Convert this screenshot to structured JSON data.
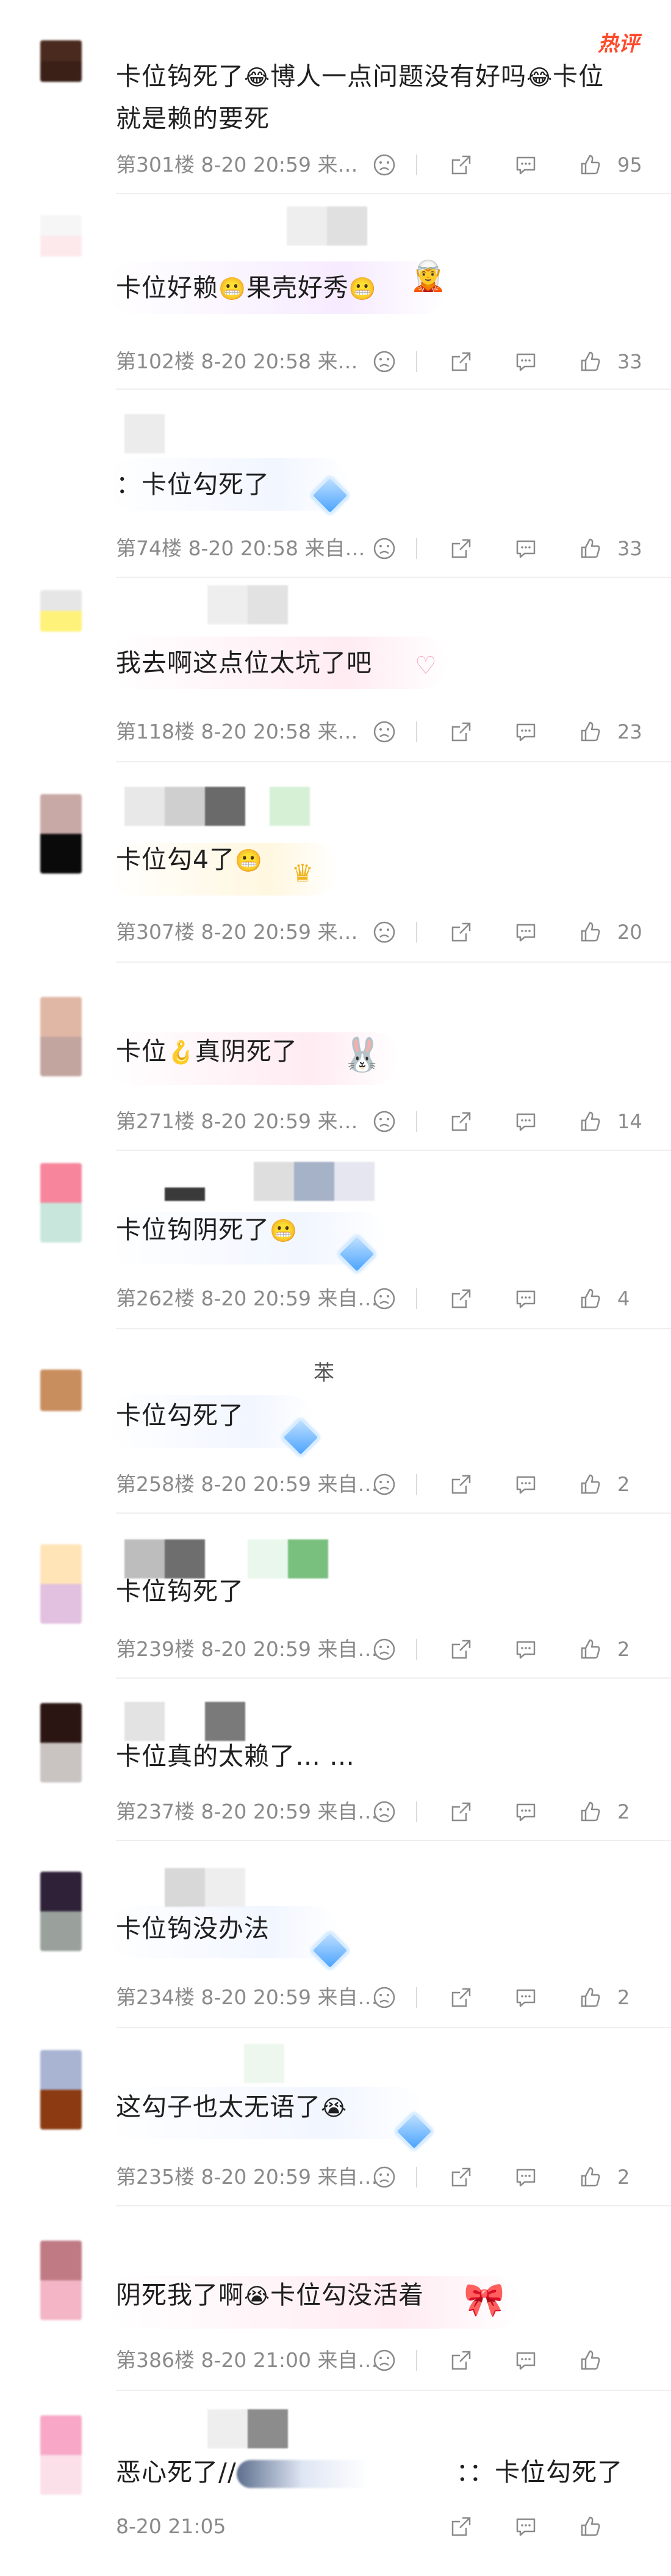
{
  "hot_badge": "热评",
  "comments": [
    {
      "content_a": "卡位钩死了",
      "emoji_a": "😂",
      "content_b": "博人一点问题没有好吗",
      "emoji_b": "😂",
      "content_c": "卡位",
      "content_line2": "就是赖的要死",
      "meta": "第301楼  8-20 20:59  来…",
      "likes": "95",
      "colors": {
        "avatar_top": "#4a2a1e",
        "avatar_bottom": "#3b2018"
      }
    },
    {
      "content_a": "卡位好赖",
      "emoji_a": "😬",
      "content_b": "果壳好秀",
      "emoji_b": "😬",
      "meta": "第102楼  8-20 20:58  来…",
      "likes": "33",
      "colors": {
        "avatar_top": "#f6f6f6",
        "avatar_bottom": "#fde8ec"
      }
    },
    {
      "content_a": "：卡位勾死了",
      "meta": "第74楼  8-20 20:58  来自…",
      "likes": "33",
      "colors": {
        "avatar_top": "#ffffff",
        "avatar_bottom": "#ffffff"
      }
    },
    {
      "content_a": "我去啊这点位太坑了吧",
      "meta": "第118楼  8-20 20:58  来…",
      "likes": "23",
      "colors": {
        "avatar_top": "#e6e6e6",
        "avatar_bottom": "#fff27a"
      }
    },
    {
      "content_a": "卡位勾4了",
      "emoji_a": "😬",
      "meta": "第307楼  8-20 20:59  来…",
      "likes": "20",
      "colors": {
        "avatar_top": "#c9a9a6",
        "avatar_bottom": "#0a0a0a"
      }
    },
    {
      "content_a": "卡位",
      "emoji_a": "🪝",
      "content_b": "真阴死了",
      "meta": "第271楼  8-20 20:59  来…",
      "likes": "14",
      "colors": {
        "avatar_top": "#e0b7a5",
        "avatar_bottom": "#c3a5a0"
      }
    },
    {
      "content_a": "卡位钩阴死了",
      "emoji_a": "😬",
      "meta": "第262楼  8-20 20:59  来自…",
      "likes": "4",
      "colors": {
        "avatar_top": "#f7869c",
        "avatar_bottom": "#c8e6dc"
      }
    },
    {
      "content_a": "卡位勾死了",
      "name_hint": "苯",
      "meta": "第258楼  8-20 20:59  来自…",
      "likes": "2",
      "colors": {
        "avatar_top": "#c98e5e",
        "avatar_bottom": "#c98e5e"
      }
    },
    {
      "content_a": "卡位钩死了",
      "meta": "第239楼  8-20 20:59  来自…",
      "likes": "2",
      "colors": {
        "avatar_top": "#ffe4b8",
        "avatar_bottom": "#e2c0e0"
      }
    },
    {
      "content_a": "卡位真的太赖了…  …",
      "meta": "第237楼  8-20 20:59  来自…",
      "likes": "2",
      "colors": {
        "avatar_top": "#2a1512",
        "avatar_bottom": "#c9c3c1"
      }
    },
    {
      "content_a": "卡位钩没办法",
      "meta": "第234楼  8-20 20:59  来自…",
      "likes": "2",
      "colors": {
        "avatar_top": "#2f2238",
        "avatar_bottom": "#9aa19d"
      }
    },
    {
      "content_a": "这勾子也太无语了",
      "emoji_a": "😭",
      "meta": "第235楼  8-20 20:59  来自…",
      "likes": "2",
      "colors": {
        "avatar_top": "#a8b4d2",
        "avatar_bottom": "#8b3a12"
      }
    },
    {
      "content_a": "阴死我了啊",
      "emoji_a": "😭",
      "content_b": "卡位勾没活着",
      "meta": "第386楼  8-20 21:00  来自…",
      "likes": "",
      "colors": {
        "avatar_top": "#c07a84",
        "avatar_bottom": "#f4b6c6"
      }
    },
    {
      "content_a": "恶心死了//",
      "content_b": "：：卡位勾死了",
      "meta": "8-20 21:05",
      "likes": "",
      "colors": {
        "avatar_top": "#f8a8c6",
        "avatar_bottom": "#fbe0ea"
      }
    }
  ]
}
